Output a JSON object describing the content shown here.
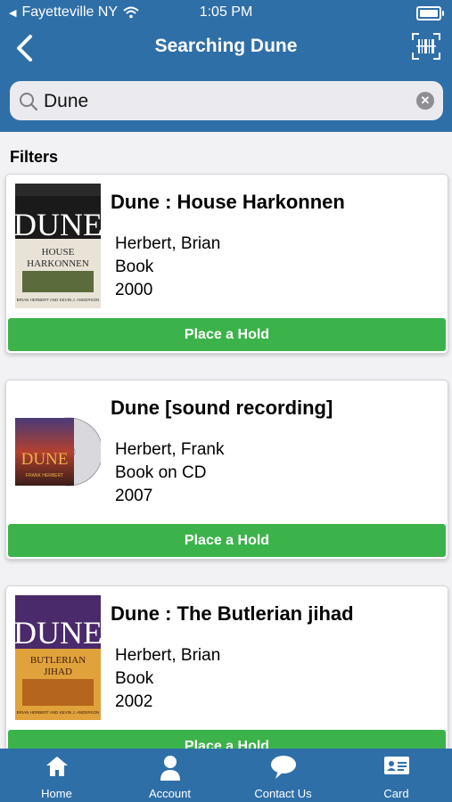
{
  "status_bar": {
    "carrier": "Fayetteville NY",
    "time": "1:05 PM"
  },
  "header": {
    "title": "Searching Dune"
  },
  "search": {
    "value": "Dune"
  },
  "filters_label": "Filters",
  "results": [
    {
      "title": "Dune : House Harkonnen",
      "author": "Herbert, Brian",
      "format": "Book",
      "year": "2000",
      "action": "Place a Hold",
      "cover_text": {
        "brand": "DUNE",
        "subtitle": "HOUSE HARKONNEN",
        "authors": "BRIAN HERBERT AND KEVIN J. ANDERSON"
      }
    },
    {
      "title": "Dune [sound recording]",
      "author": "Herbert, Frank",
      "format": "Book on CD",
      "year": "2007",
      "action": "Place a Hold",
      "cover_text": {
        "brand": "DUNE",
        "authors": "FRANK HERBERT"
      }
    },
    {
      "title": "Dune  : The Butlerian jihad",
      "author": "Herbert, Brian",
      "format": "Book",
      "year": "2002",
      "action": "Place a Hold",
      "cover_text": {
        "brand": "DUNE",
        "subtitle": "BUTLERIAN JIHAD",
        "authors": "BRIAN HERBERT AND KEVIN J. ANDERSON"
      }
    }
  ],
  "tabs": [
    {
      "label": "Home",
      "icon": "home-icon"
    },
    {
      "label": "Account",
      "icon": "person-icon"
    },
    {
      "label": "Contact Us",
      "icon": "chat-bubble-icon"
    },
    {
      "label": "Card",
      "icon": "id-card-icon"
    }
  ],
  "colors": {
    "header_bg": "#2f6fa8",
    "hold_button": "#3cb34a",
    "search_bg": "#ebebef"
  }
}
